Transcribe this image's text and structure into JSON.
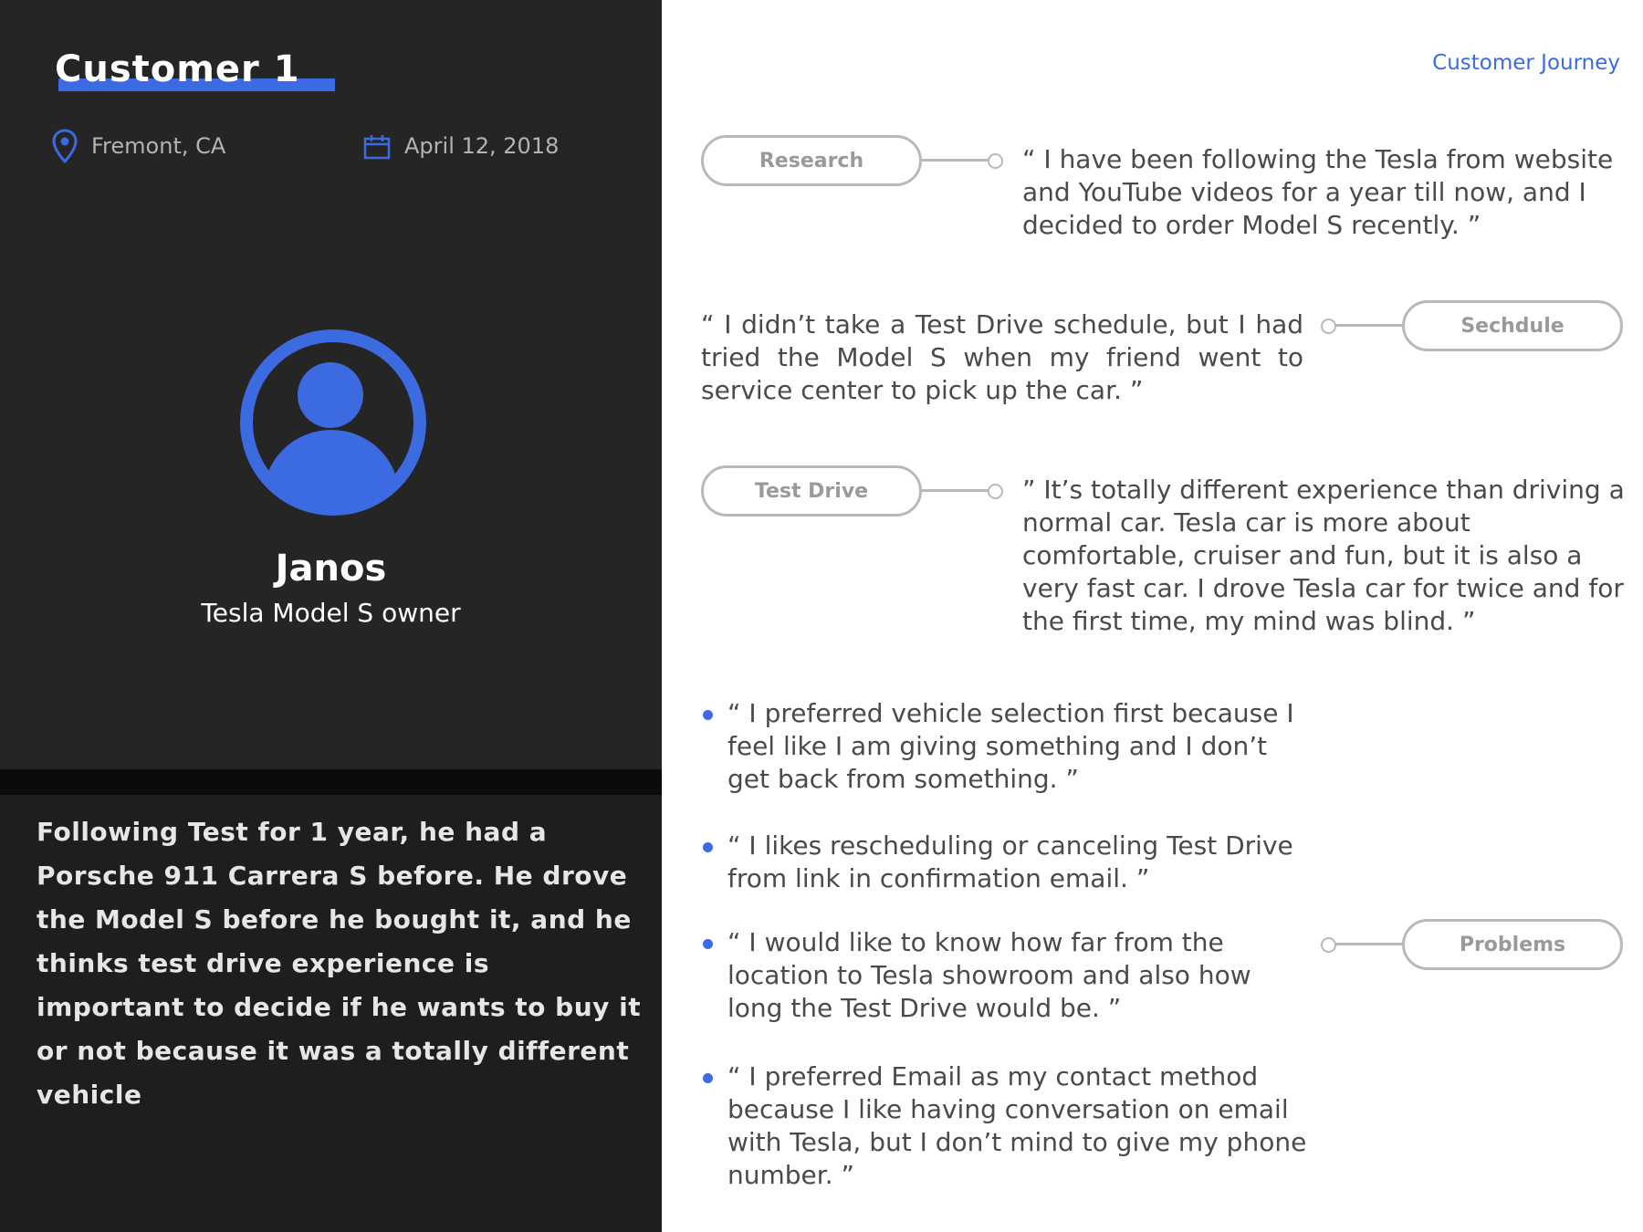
{
  "customer": {
    "title": "Customer 1",
    "location": "Fremont, CA",
    "date": "April 12, 2018",
    "name": "Janos",
    "role": "Tesla Model S owner",
    "summary": "Following Test for 1 year, he had a Porsche 911 Carrera S before. He drove the Model S before he bought it, and he thinks test drive experience is important to decide if he wants to buy it or not because it was a totally different vehicle"
  },
  "journey": {
    "link_label": "Customer Journey",
    "stages": [
      {
        "label": "Research",
        "quote": "“ I have been following the Tesla from website and YouTube videos for a year till now, and I decided to order Model S recently. ”"
      },
      {
        "label": "Sechdule",
        "quote": "“ I didn’t take a Test Drive schedule, but I had tried the Model S when my friend went to service center to pick up the car. ”"
      },
      {
        "label": "Test Drive",
        "quote": "” It’s totally different experience than driving a normal car. Tesla car is more about comfortable, cruiser and fun, but it is also a very fast car. I drove Tesla car for twice and for the first time, my mind was blind. ”"
      },
      {
        "label": "Problems"
      }
    ],
    "problems": [
      "“ I preferred vehicle selection first because I feel like I am giving something and I don’t get back from something. ”",
      "“ I likes rescheduling or canceling Test Drive from link in confirmation email. ”",
      "“ I would like to know how far from the location to Tesla showroom and also how long the Test Drive would be. ”",
      "“ I preferred Email as my contact method because I like having conversation on email with Tesla, but I don’t mind to give my phone number. ”"
    ]
  },
  "icons": {
    "location": "map-pin-icon",
    "date": "calendar-icon",
    "avatar": "user-avatar-icon"
  },
  "colors": {
    "accent": "#3c6ae0",
    "panel_dark": "#252526",
    "stage_border": "#b9b9b9"
  }
}
